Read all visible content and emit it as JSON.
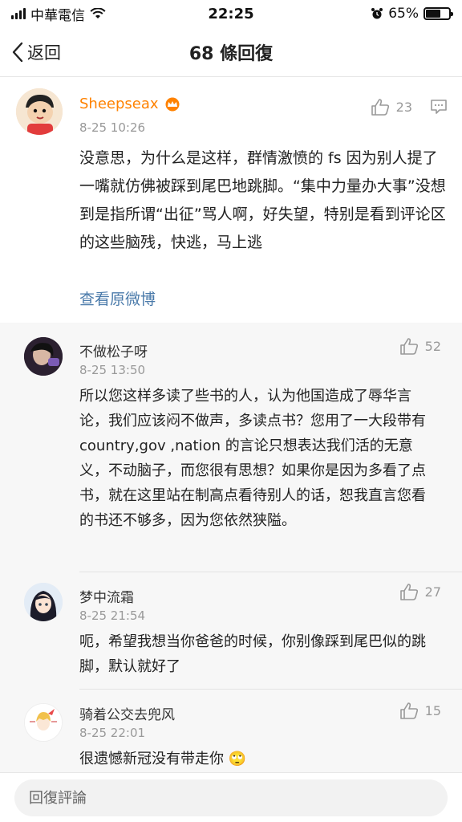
{
  "status_bar": {
    "carrier": "中華電信",
    "time": "22:25",
    "battery": "65%",
    "battery_level": 0.65
  },
  "nav": {
    "back_label": "返回",
    "title": "68 條回復"
  },
  "post": {
    "user": "Sheepseax",
    "time": "8-25 10:26",
    "likes": "23",
    "text": "没意思，为什么是这样，群情激愤的 fs 因为别人提了一嘴就仿佛被踩到尾巴地跳脚。“集中力量办大事”没想到是指所谓“出征”骂人啊，好失望，特别是看到评论区的这些脑残，快逃，马上逃",
    "view_original": "查看原微博"
  },
  "replies": [
    {
      "user": "不做松子呀",
      "time": "8-25 13:50",
      "likes": "52",
      "text": "所以您这样多读了些书的人，认为他国造成了辱华言论，我们应该闷不做声，多读点书？您用了一大段带有 country,gov ,nation 的言论只想表达我们活的无意义，不动脑子，而您很有思想？如果你是因为多看了点书，就在这里站在制高点看待别人的话，恕我直言您看的书还不够多，因为您依然狭隘。"
    },
    {
      "user": "梦中流霜",
      "time": "8-25 21:54",
      "likes": "27",
      "text": "呃，希望我想当你爸爸的时候，你别像踩到尾巴似的跳脚，默认就好了"
    },
    {
      "user": "骑着公交去兜风",
      "time": "8-25 22:01",
      "likes": "15",
      "text": "很遗憾新冠没有带走你 🙄"
    }
  ],
  "bottom": {
    "placeholder": "回復評論"
  },
  "colors": {
    "accent": "#ff8200",
    "link": "#4a7aaa",
    "muted": "#999999"
  }
}
